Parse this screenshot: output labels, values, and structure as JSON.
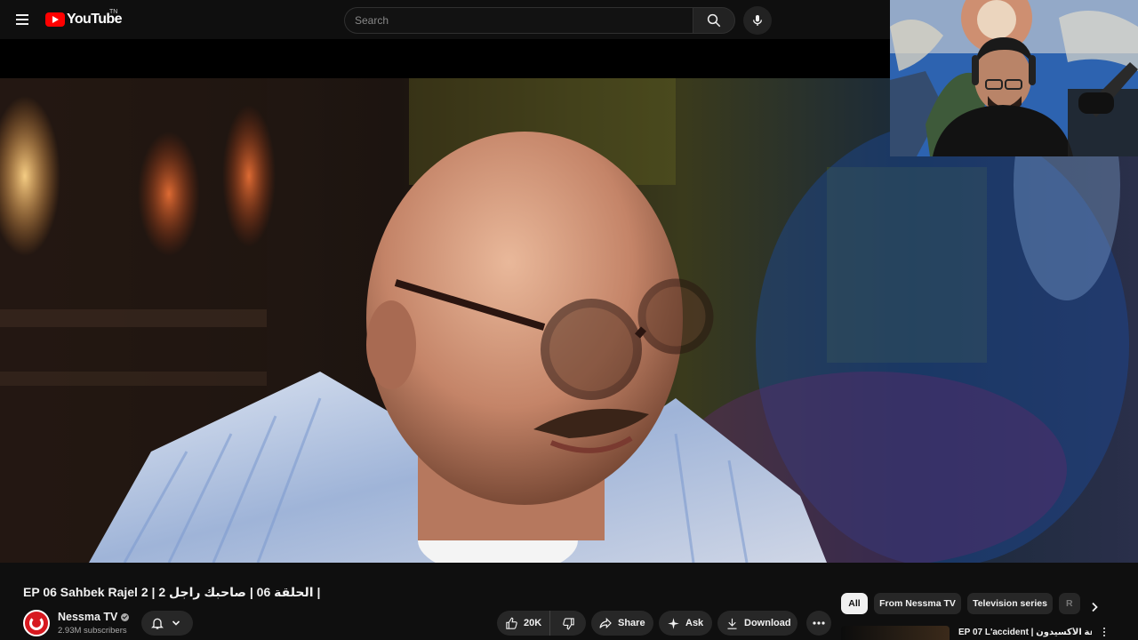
{
  "header": {
    "logo_text": "YouTube",
    "logo_tm": "TN",
    "search_placeholder": "Search",
    "icons": [
      "menu-icon",
      "search-icon",
      "mic-icon"
    ]
  },
  "video": {
    "title": "EP 06 Sahbek Rajel 2 | الحلقة 06 | صاحبك راجل 2 |"
  },
  "channel": {
    "name": "Nessma TV",
    "subscribers": "2.93M subscribers",
    "verified": true
  },
  "actions": {
    "like_count": "20K",
    "share_label": "Share",
    "ask_label": "Ask",
    "download_label": "Download"
  },
  "chips": {
    "items": [
      "All",
      "From Nessma TV",
      "Television series",
      "R"
    ],
    "active": "All"
  },
  "recommendation": {
    "title": "EP 07 L'accident | الحلقة الأكسيدون"
  },
  "colors": {
    "accent_red": "#ff0000",
    "background": "#0f0f0f",
    "pill": "#272727",
    "text": "#f1f1f1",
    "subtext": "#aaaaaa"
  }
}
